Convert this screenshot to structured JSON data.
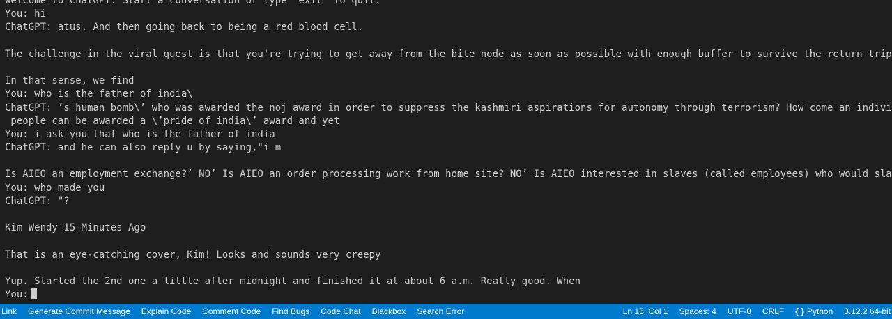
{
  "terminal": {
    "lines": [
      "Welcome to ChatGPT. Start a conversation or type 'exit' to quit.",
      "You: hi",
      "ChatGPT: atus. And then going back to being a red blood cell.",
      "",
      "The challenge in the viral quest is that you're trying to get away from the bite node as soon as possible with enough buffer to survive the return trip.",
      "",
      "In that sense, we find",
      "You: who is the father of india\\",
      "ChatGPT: ’s human bomb\\’ who was awarded the noj award in order to suppress the kashmiri aspirations for autonomy through terrorism? How come an individual or a",
      " people can be awarded a \\’pride of india\\’ award and yet",
      "You: i ask you that who is the father of india",
      "ChatGPT: and he can also reply u by saying,\"i m",
      "",
      "Is AIEO an employment exchange?’ NO’ Is AIEO an order processing work from home site? NO’ Is AIEO interested in slaves (called employees) who would slave",
      "You: who made you",
      "ChatGPT: \"?",
      "",
      "Kim Wendy 15 Minutes Ago",
      "",
      "That is an eye-catching cover, Kim! Looks and sounds very creepy",
      "",
      "Yup. Started the 2nd one a little after midnight and finished it at about 6 a.m. Really good. When"
    ],
    "prompt": "You:"
  },
  "statusbar": {
    "left": [
      "ve Link",
      "Generate Commit Message",
      "Explain Code",
      "Comment Code",
      "Find Bugs",
      "Code Chat",
      "Blackbox",
      "Search Error"
    ],
    "position": "Ln 15, Col 1",
    "spaces": "Spaces: 4",
    "encoding": "UTF-8",
    "eol": "CRLF",
    "language_icon": "{ }",
    "language": "Python",
    "version": "3.12.2 64-bit"
  },
  "colors": {
    "terminal_bg": "#1e1e1e",
    "terminal_fg": "#cccccc",
    "statusbar_bg": "#007acc",
    "statusbar_fg": "#ffffff"
  }
}
